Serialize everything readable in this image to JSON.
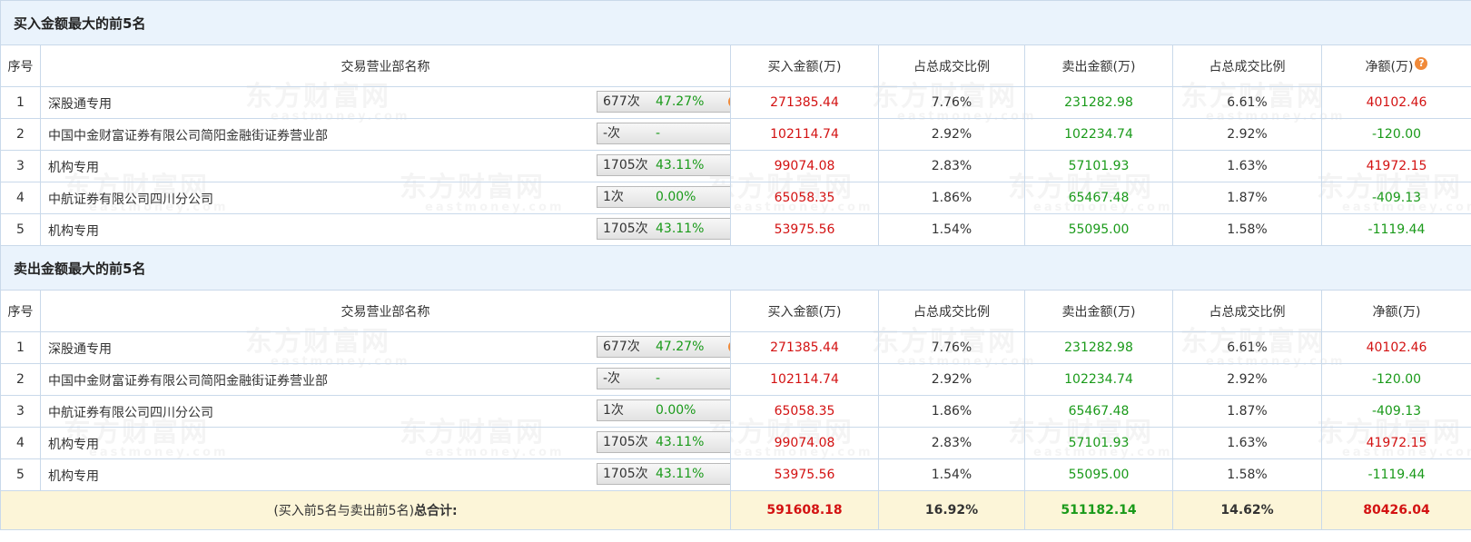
{
  "watermark": {
    "text": "东方财富网",
    "sub": "eastmoney.com"
  },
  "columns": {
    "idx": "序号",
    "branch": "交易营业部名称",
    "buy": "买入金额(万)",
    "buy_ratio": "占总成交比例",
    "sell": "卖出金额(万)",
    "sell_ratio": "占总成交比例",
    "net": "净额(万)"
  },
  "buy_section": {
    "title": "买入金额最大的前5名",
    "rows": [
      {
        "idx": "1",
        "name": "深股通专用",
        "count": "677次",
        "rate": "47.27%",
        "control": "help",
        "buy": "271385.44",
        "buy_ratio": "7.76%",
        "sell": "231282.98",
        "sell_ratio": "6.61%",
        "net": "40102.46",
        "net_sign": "pos"
      },
      {
        "idx": "2",
        "name": "中国中金财富证券有限公司简阳金融街证券营业部",
        "count": "-次",
        "rate": "-",
        "control": "arrow",
        "buy": "102114.74",
        "buy_ratio": "2.92%",
        "sell": "102234.74",
        "sell_ratio": "2.92%",
        "net": "-120.00",
        "net_sign": "neg"
      },
      {
        "idx": "3",
        "name": "机构专用",
        "count": "1705次",
        "rate": "43.11%",
        "control": "arrow",
        "buy": "99074.08",
        "buy_ratio": "2.83%",
        "sell": "57101.93",
        "sell_ratio": "1.63%",
        "net": "41972.15",
        "net_sign": "pos"
      },
      {
        "idx": "4",
        "name": "中航证券有限公司四川分公司",
        "count": "1次",
        "rate": "0.00%",
        "control": "arrow",
        "buy": "65058.35",
        "buy_ratio": "1.86%",
        "sell": "65467.48",
        "sell_ratio": "1.87%",
        "net": "-409.13",
        "net_sign": "neg"
      },
      {
        "idx": "5",
        "name": "机构专用",
        "count": "1705次",
        "rate": "43.11%",
        "control": "arrow",
        "buy": "53975.56",
        "buy_ratio": "1.54%",
        "sell": "55095.00",
        "sell_ratio": "1.58%",
        "net": "-1119.44",
        "net_sign": "neg"
      }
    ]
  },
  "sell_section": {
    "title": "卖出金额最大的前5名",
    "rows": [
      {
        "idx": "1",
        "name": "深股通专用",
        "count": "677次",
        "rate": "47.27%",
        "control": "help",
        "buy": "271385.44",
        "buy_ratio": "7.76%",
        "sell": "231282.98",
        "sell_ratio": "6.61%",
        "net": "40102.46",
        "net_sign": "pos"
      },
      {
        "idx": "2",
        "name": "中国中金财富证券有限公司简阳金融街证券营业部",
        "count": "-次",
        "rate": "-",
        "control": "arrow",
        "buy": "102114.74",
        "buy_ratio": "2.92%",
        "sell": "102234.74",
        "sell_ratio": "2.92%",
        "net": "-120.00",
        "net_sign": "neg"
      },
      {
        "idx": "3",
        "name": "中航证券有限公司四川分公司",
        "count": "1次",
        "rate": "0.00%",
        "control": "arrow",
        "buy": "65058.35",
        "buy_ratio": "1.86%",
        "sell": "65467.48",
        "sell_ratio": "1.87%",
        "net": "-409.13",
        "net_sign": "neg"
      },
      {
        "idx": "4",
        "name": "机构专用",
        "count": "1705次",
        "rate": "43.11%",
        "control": "arrow",
        "buy": "99074.08",
        "buy_ratio": "2.83%",
        "sell": "57101.93",
        "sell_ratio": "1.63%",
        "net": "41972.15",
        "net_sign": "pos"
      },
      {
        "idx": "5",
        "name": "机构专用",
        "count": "1705次",
        "rate": "43.11%",
        "control": "arrow",
        "buy": "53975.56",
        "buy_ratio": "1.54%",
        "sell": "55095.00",
        "sell_ratio": "1.58%",
        "net": "-1119.44",
        "net_sign": "neg"
      }
    ]
  },
  "total": {
    "label_prefix": "(买入前5名与卖出前5名)",
    "label_bold": "总合计:",
    "buy": "591608.18",
    "buy_ratio": "16.92%",
    "sell": "511182.14",
    "sell_ratio": "14.62%",
    "net": "80426.04"
  },
  "colors": {
    "positive": "#d31212",
    "negative": "#1a9a1a",
    "section_bg": "#eaf3fc",
    "total_bg": "#fcf5d8",
    "border": "#c9d9ea",
    "help_icon": "#f08a3a",
    "arrow_icon": "#2a4b8d"
  }
}
